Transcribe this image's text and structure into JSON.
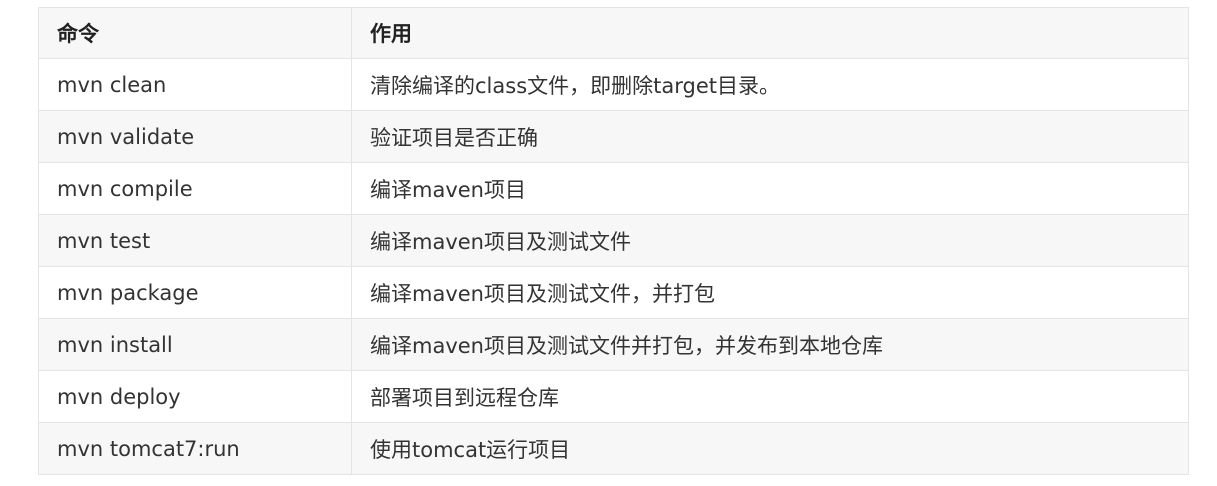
{
  "table": {
    "headers": [
      "命令",
      "作用"
    ],
    "rows": [
      {
        "command": "mvn clean",
        "description": "清除编译的class文件，即删除target目录。"
      },
      {
        "command": "mvn validate",
        "description": "验证项目是否正确"
      },
      {
        "command": "mvn compile",
        "description": "编译maven项目"
      },
      {
        "command": "mvn test",
        "description": "编译maven项目及测试文件"
      },
      {
        "command": "mvn package",
        "description": "编译maven项目及测试文件，并打包"
      },
      {
        "command": "mvn install",
        "description": "编译maven项目及测试文件并打包，并发布到本地仓库"
      },
      {
        "command": "mvn deploy",
        "description": "部署项目到远程仓库"
      },
      {
        "command": "mvn tomcat7:run",
        "description": "使用tomcat运行项目"
      }
    ]
  }
}
